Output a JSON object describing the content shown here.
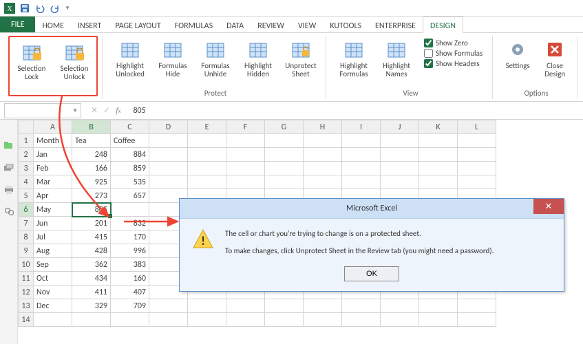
{
  "qat": {
    "items": [
      "excel",
      "save",
      "undo",
      "redo"
    ]
  },
  "tabs": [
    "FILE",
    "HOME",
    "INSERT",
    "PAGE LAYOUT",
    "FORMULAS",
    "DATA",
    "REVIEW",
    "VIEW",
    "KUTOOLS",
    "ENTERPRISE",
    "DESIGN"
  ],
  "active_tab": "DESIGN",
  "ribbon": {
    "groups": [
      {
        "label": "",
        "highlight": true,
        "items": [
          {
            "label": "Selection Lock",
            "icon": "lock"
          },
          {
            "label": "Selection Unlock",
            "icon": "unlock"
          }
        ]
      },
      {
        "label": "Protect",
        "items": [
          {
            "label": "Highlight Unlocked",
            "icon": "highlight-unlocked"
          },
          {
            "label": "Formulas Hide",
            "icon": "formulas-hide"
          },
          {
            "label": "Formulas Unhide",
            "icon": "formulas-unhide"
          },
          {
            "label": "Highlight Hidden",
            "icon": "highlight-hidden"
          },
          {
            "label": "Unprotect Sheet",
            "icon": "unprotect-sheet"
          }
        ]
      },
      {
        "label": "View",
        "items": [
          {
            "label": "Highlight Formulas",
            "icon": "highlight-formulas"
          },
          {
            "label": "Highlight Names",
            "icon": "highlight-names"
          }
        ],
        "checks": [
          {
            "label": "Show Zero",
            "checked": true
          },
          {
            "label": "Show Formulas",
            "checked": false
          },
          {
            "label": "Show Headers",
            "checked": true
          }
        ]
      },
      {
        "label": "Options",
        "items": [
          {
            "label": "Settings",
            "icon": "settings"
          },
          {
            "label": "Close Design",
            "icon": "close-design"
          }
        ]
      }
    ]
  },
  "namebox": "",
  "fx_value": "805",
  "columns": [
    "A",
    "B",
    "C",
    "D",
    "E",
    "F",
    "G",
    "H",
    "I",
    "J",
    "K",
    "L"
  ],
  "headers": {
    "A": "Month",
    "B": "Tea",
    "C": "Coffee"
  },
  "rows": [
    {
      "n": 1,
      "A": "Month",
      "B": "Tea",
      "C": "Coffee"
    },
    {
      "n": 2,
      "A": "Jan",
      "B": 248,
      "C": 884
    },
    {
      "n": 3,
      "A": "Feb",
      "B": 166,
      "C": 859
    },
    {
      "n": 4,
      "A": "Mar",
      "B": 925,
      "C": 535
    },
    {
      "n": 5,
      "A": "Apr",
      "B": 273,
      "C": 657
    },
    {
      "n": 6,
      "A": "May",
      "B": 805,
      "C": ""
    },
    {
      "n": 7,
      "A": "Jun",
      "B": 201,
      "C": 832
    },
    {
      "n": 8,
      "A": "Jul",
      "B": 415,
      "C": 170
    },
    {
      "n": 9,
      "A": "Aug",
      "B": 428,
      "C": 996
    },
    {
      "n": 10,
      "A": "Sep",
      "B": 362,
      "C": 383
    },
    {
      "n": 11,
      "A": "Oct",
      "B": 434,
      "C": 160
    },
    {
      "n": 12,
      "A": "Nov",
      "B": 411,
      "C": 407
    },
    {
      "n": 13,
      "A": "Dec",
      "B": 329,
      "C": 709
    },
    {
      "n": 14,
      "A": "",
      "B": "",
      "C": ""
    }
  ],
  "active_cell": {
    "row": 6,
    "col": "B"
  },
  "dialog": {
    "title": "Microsoft Excel",
    "line1": "The cell or chart you're trying to change is on a protected sheet.",
    "line2": "To make changes, click Unprotect Sheet in the Review tab (you might need a password).",
    "ok": "OK"
  }
}
